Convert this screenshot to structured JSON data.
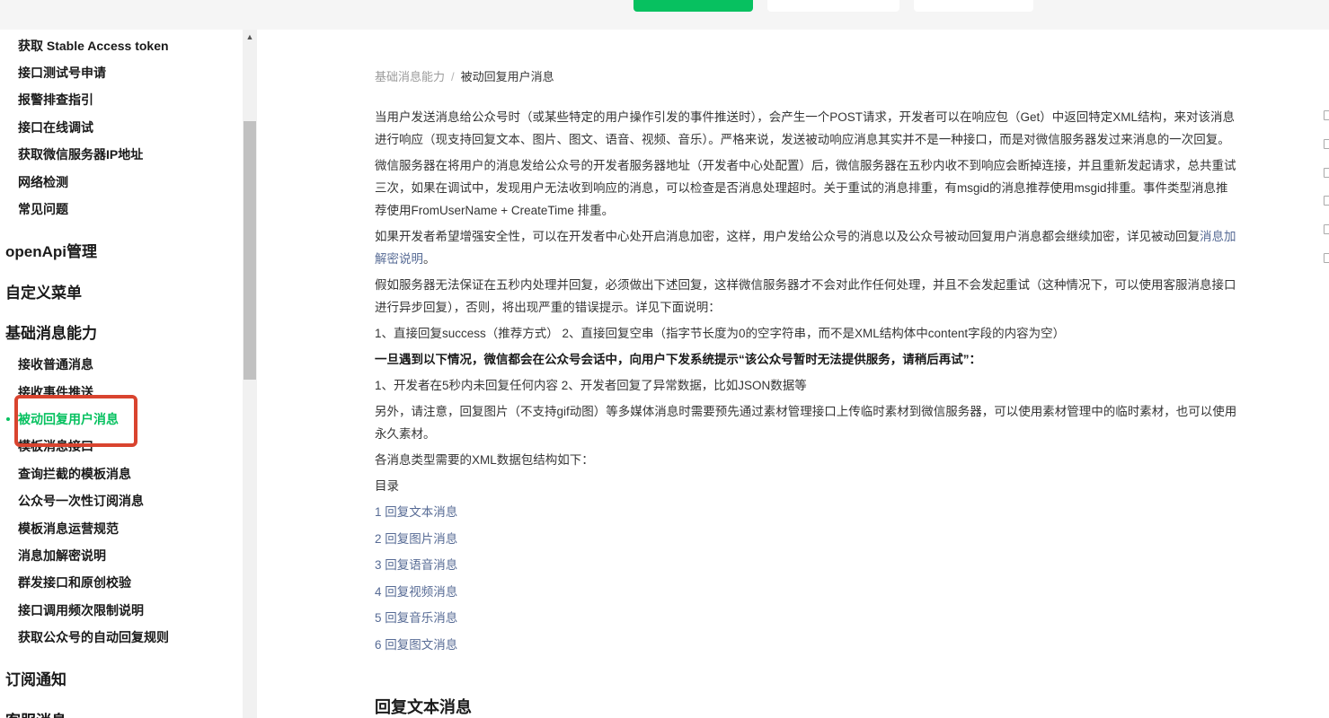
{
  "sidebar": {
    "items_top": [
      "获取 Stable Access token",
      "接口测试号申请",
      "报警排查指引",
      "接口在线调试",
      "获取微信服务器IP地址",
      "网络检测",
      "常见问题"
    ],
    "groups": {
      "openapi": "openApi管理",
      "custom_menu": "自定义菜单",
      "basic_message": "基础消息能力",
      "subscribe": "订阅通知",
      "partial_next": "客服消息"
    },
    "basic_items": [
      "接收普通消息",
      "接收事件推送",
      "被动回复用户消息",
      "模板消息接口",
      "查询拦截的模板消息",
      "公众号一次性订阅消息",
      "模板消息运营规范",
      "消息加解密说明",
      "群发接口和原创校验",
      "接口调用频次限制说明",
      "获取公众号的自动回复规则"
    ],
    "active_item": "被动回复用户消息"
  },
  "breadcrumb": {
    "parent": "基础消息能力",
    "separator": "/",
    "current": "被动回复用户消息"
  },
  "content": {
    "p1": "当用户发送消息给公众号时（或某些特定的用户操作引发的事件推送时），会产生一个POST请求，开发者可以在响应包（Get）中返回特定XML结构，来对该消息进行响应（现支持回复文本、图片、图文、语音、视频、音乐）。严格来说，发送被动响应消息其实并不是一种接口，而是对微信服务器发过来消息的一次回复。",
    "p2": "微信服务器在将用户的消息发给公众号的开发者服务器地址（开发者中心处配置）后，微信服务器在五秒内收不到响应会断掉连接，并且重新发起请求，总共重试三次，如果在调试中，发现用户无法收到响应的消息，可以检查是否消息处理超时。关于重试的消息排重，有msgid的消息推荐使用msgid排重。事件类型消息推荐使用FromUserName + CreateTime 排重。",
    "p3_text": "如果开发者希望增强安全性，可以在开发者中心处开启消息加密，这样，用户发给公众号的消息以及公众号被动回复用户消息都会继续加密，详见被动回复",
    "p3_link": "消息加解密说明",
    "p3_end": "。",
    "p4": "假如服务器无法保证在五秒内处理并回复，必须做出下述回复，这样微信服务器才不会对此作任何处理，并且不会发起重试（这种情况下，可以使用客服消息接口进行异步回复），否则，将出现严重的错误提示。详见下面说明：",
    "p5": "1、直接回复success（推荐方式） 2、直接回复空串（指字节长度为0的空字符串，而不是XML结构体中content字段的内容为空）",
    "p6_bold": "一旦遇到以下情况，微信都会在公众号会话中，向用户下发系统提示“该公众号暂时无法提供服务，请稍后再试”：",
    "p7": "1、开发者在5秒内未回复任何内容 2、开发者回复了异常数据，比如JSON数据等",
    "p8": "另外，请注意，回复图片（不支持gif动图）等多媒体消息时需要预先通过素材管理接口上传临时素材到微信服务器，可以使用素材管理中的临时素材，也可以使用永久素材。",
    "p9": "各消息类型需要的XML数据包结构如下：",
    "toc_title": "目录",
    "toc": [
      "1 回复文本消息",
      "2 回复图片消息",
      "3 回复语音消息",
      "4 回复视频消息",
      "5 回复音乐消息",
      "6 回复图文消息"
    ],
    "section_heading": "回复文本消息"
  },
  "colors": {
    "accent_green": "#07c160",
    "link_blue": "#576b95",
    "highlight_red": "#d9442f"
  }
}
